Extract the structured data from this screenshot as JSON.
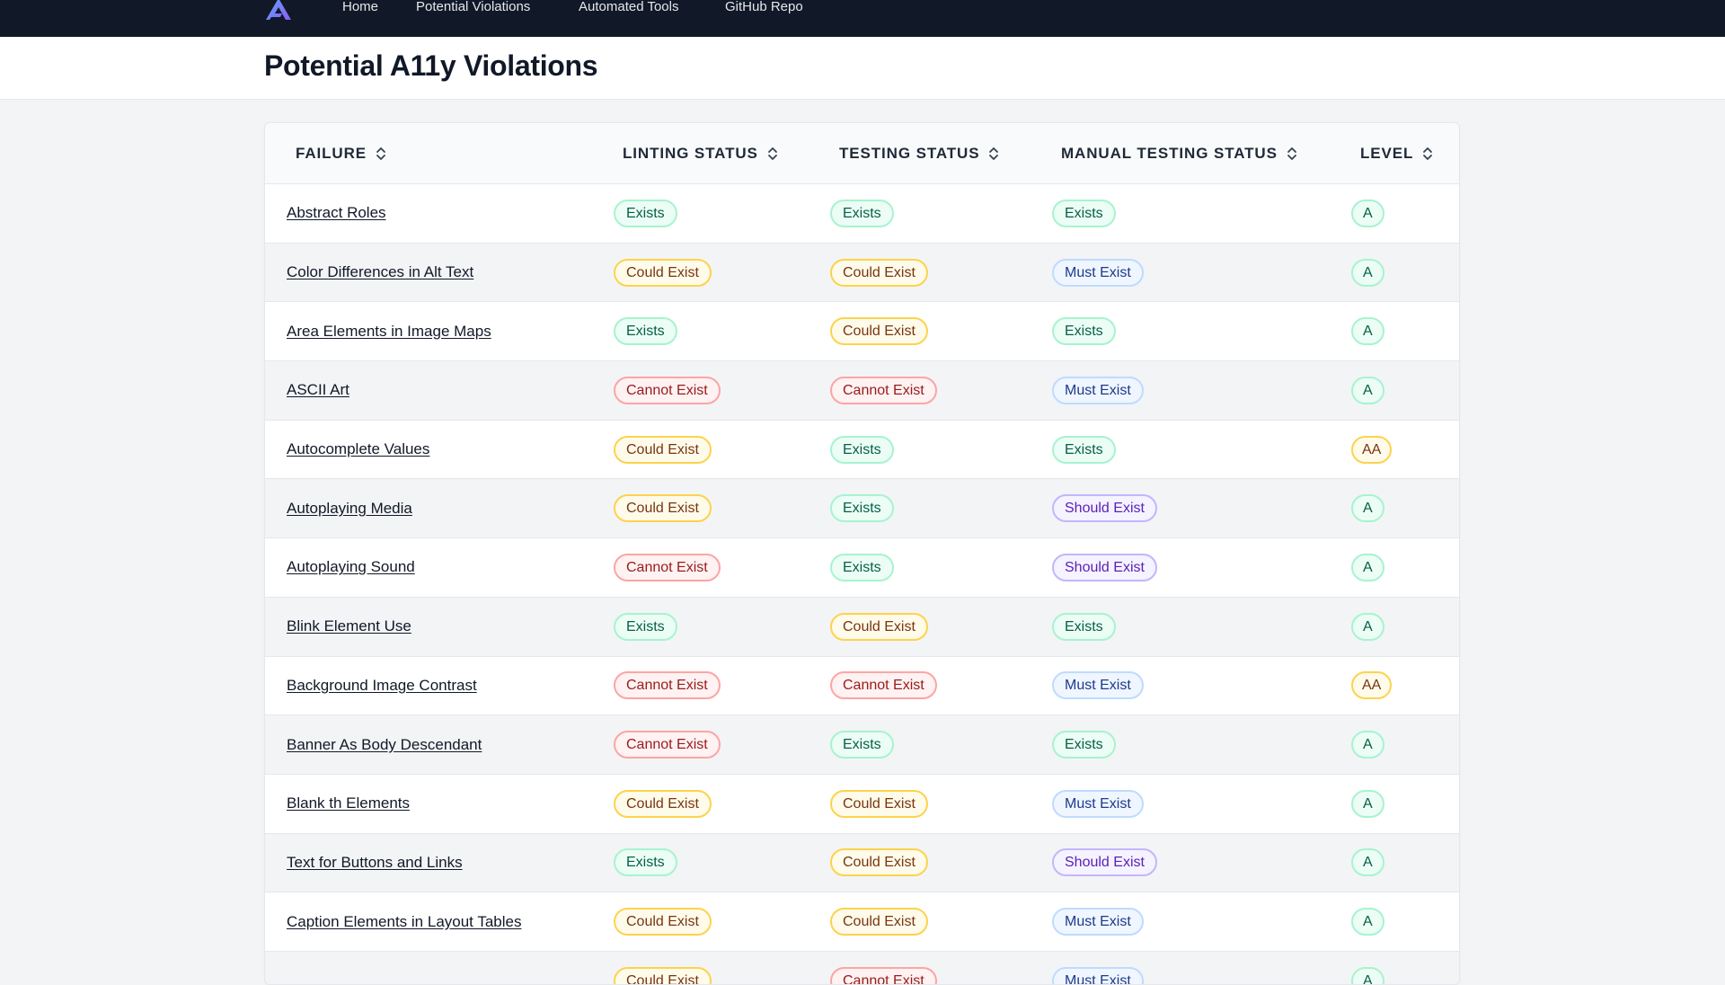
{
  "nav": {
    "logo_icon": "app-logo",
    "links": [
      "Home",
      "Potential Violations",
      "Automated Tools",
      "GitHub Repo"
    ]
  },
  "header": {
    "title": "Potential A11y Violations"
  },
  "table": {
    "columns": [
      "FAILURE",
      "LINTING STATUS",
      "TESTING STATUS",
      "MANUAL TESTING STATUS",
      "LEVEL"
    ],
    "sort_icon": "sort-updown-icon",
    "rows": [
      {
        "failure": "Abstract Roles",
        "linting": "Exists",
        "testing": "Exists",
        "manual": "Exists",
        "level": "A"
      },
      {
        "failure": "Color Differences in Alt Text",
        "linting": "Could Exist",
        "testing": "Could Exist",
        "manual": "Must Exist",
        "level": "A"
      },
      {
        "failure": "Area Elements in Image Maps",
        "linting": "Exists",
        "testing": "Could Exist",
        "manual": "Exists",
        "level": "A"
      },
      {
        "failure": "ASCII Art",
        "linting": "Cannot Exist",
        "testing": "Cannot Exist",
        "manual": "Must Exist",
        "level": "A"
      },
      {
        "failure": "Autocomplete Values",
        "linting": "Could Exist",
        "testing": "Exists",
        "manual": "Exists",
        "level": "AA"
      },
      {
        "failure": "Autoplaying Media",
        "linting": "Could Exist",
        "testing": "Exists",
        "manual": "Should Exist",
        "level": "A"
      },
      {
        "failure": "Autoplaying Sound",
        "linting": "Cannot Exist",
        "testing": "Exists",
        "manual": "Should Exist",
        "level": "A"
      },
      {
        "failure": "Blink Element Use",
        "linting": "Exists",
        "testing": "Could Exist",
        "manual": "Exists",
        "level": "A"
      },
      {
        "failure": "Background Image Contrast",
        "linting": "Cannot Exist",
        "testing": "Cannot Exist",
        "manual": "Must Exist",
        "level": "AA"
      },
      {
        "failure": "Banner As Body Descendant",
        "linting": "Cannot Exist",
        "testing": "Exists",
        "manual": "Exists",
        "level": "A"
      },
      {
        "failure": "Blank th Elements",
        "linting": "Could Exist",
        "testing": "Could Exist",
        "manual": "Must Exist",
        "level": "A"
      },
      {
        "failure": "Text for Buttons and Links",
        "linting": "Exists",
        "testing": "Could Exist",
        "manual": "Should Exist",
        "level": "A"
      },
      {
        "failure": "Caption Elements in Layout Tables",
        "linting": "Could Exist",
        "testing": "Could Exist",
        "manual": "Must Exist",
        "level": "A"
      },
      {
        "failure": "",
        "linting": "Could Exist",
        "testing": "Cannot Exist",
        "manual": "Must Exist",
        "level": "A"
      }
    ]
  },
  "colors": {
    "nav_bg": "#111827",
    "exists": "#065f46",
    "could_exist": "#78350f",
    "cannot_exist": "#991b1b",
    "must_exist": "#1e3a8a",
    "should_exist": "#5b21b6"
  }
}
